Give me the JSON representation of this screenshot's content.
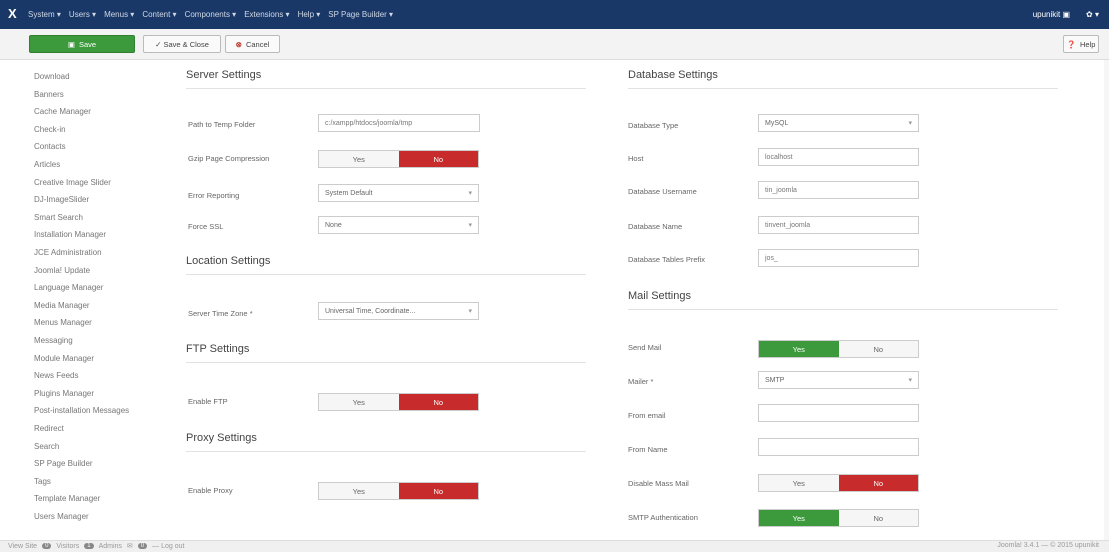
{
  "nav": {
    "logo": "X",
    "menu": [
      "System ▾",
      "Users ▾",
      "Menus ▾",
      "Content ▾",
      "Components ▾",
      "Extensions ▾",
      "Help ▾",
      "SP Page Builder ▾"
    ],
    "user": "upunikit ▣",
    "settings": "✿ ▾"
  },
  "toolbar": {
    "save": "Save",
    "save_close": "✓ Save & Close",
    "cancel": "Cancel",
    "help": "Help"
  },
  "sidebar": {
    "items": [
      "Download",
      "Banners",
      "Cache Manager",
      "Check-in",
      "Contacts",
      "Articles",
      "Creative Image Slider",
      "DJ-ImageSlider",
      "Smart Search",
      "Installation Manager",
      "JCE Administration",
      "Joomla! Update",
      "Language Manager",
      "Media Manager",
      "Menus Manager",
      "Messaging",
      "Module Manager",
      "News Feeds",
      "Plugins Manager",
      "Post-installation Messages",
      "Redirect",
      "Search",
      "SP Page Builder",
      "Tags",
      "Template Manager",
      "Users Manager"
    ]
  },
  "server": {
    "heading": "Server Settings",
    "temp_label": "Path to Temp Folder",
    "temp_value": "c:/xampp/htdocs/joomla/tmp",
    "gzip_label": "Gzip Page Compression",
    "gzip_yes": "Yes",
    "gzip_no": "No",
    "error_label": "Error Reporting",
    "error_value": "System Default",
    "ssl_label": "Force SSL",
    "ssl_value": "None"
  },
  "location": {
    "heading": "Location Settings",
    "tz_label": "Server Time Zone *",
    "tz_value": "Universal Time, Coordinate..."
  },
  "ftp": {
    "heading": "FTP Settings",
    "enable_label": "Enable FTP",
    "yes": "Yes",
    "no": "No"
  },
  "proxy": {
    "heading": "Proxy Settings",
    "enable_label": "Enable Proxy",
    "yes": "Yes",
    "no": "No"
  },
  "database": {
    "heading": "Database Settings",
    "type_label": "Database Type",
    "type_value": "MySQL",
    "host_label": "Host",
    "host_value": "localhost",
    "user_label": "Database Username",
    "user_value": "tin_joomla",
    "name_label": "Database Name",
    "name_value": "tinvent_joomla",
    "prefix_label": "Database Tables Prefix",
    "prefix_value": "jos_"
  },
  "mail": {
    "heading": "Mail Settings",
    "send_label": "Send Mail",
    "send_yes": "Yes",
    "send_no": "No",
    "mailer_label": "Mailer *",
    "mailer_value": "SMTP",
    "from_email_label": "From email",
    "from_name_label": "From Name",
    "mass_label": "Disable Mass Mail",
    "mass_yes": "Yes",
    "mass_no": "No",
    "smtp_auth_label": "SMTP Authentication",
    "smtp_yes": "Yes",
    "smtp_no": "No"
  },
  "status": {
    "view_site": "View Site",
    "visitors_badge": "0",
    "visitors": "Visitors",
    "admins_badge": "1",
    "admins": "Admins",
    "messages_badge": "0",
    "logout": "— Log out",
    "right": "Joomla! 3.4.1 — © 2015 upunikit"
  }
}
